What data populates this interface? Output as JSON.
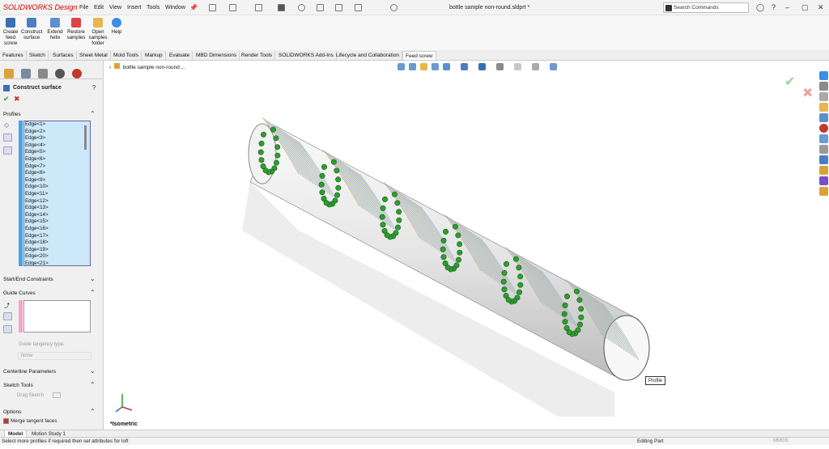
{
  "titlebar": {
    "app_name": "SOLIDWORKS Design",
    "menus": [
      "File",
      "Edit",
      "View",
      "Insert",
      "Tools",
      "Window"
    ],
    "document_title": "bottle sample non-round.sldprt *",
    "search_placeholder": "Search Commands"
  },
  "command_manager": {
    "tools": [
      {
        "label": "Create feed screw",
        "icon": "feed-screw-icon"
      },
      {
        "label": "Construct surface",
        "icon": "construct-surface-icon"
      },
      {
        "label": "Extend helix",
        "icon": "extend-helix-icon"
      },
      {
        "label": "Restore samples",
        "icon": "restore-samples-icon"
      },
      {
        "label": "Open samples folder",
        "icon": "folder-icon"
      },
      {
        "label": "Help",
        "icon": "help-icon"
      }
    ],
    "tabs": [
      "Features",
      "Sketch",
      "Surfaces",
      "Sheet Metal",
      "Mold Tools",
      "Markup",
      "Evaluate",
      "MBD Dimensions",
      "Render Tools",
      "SOLIDWORKS Add-Ins",
      "Lifecycle and Collaboration",
      "Feed screw"
    ],
    "active_tab": "Feed screw"
  },
  "property_manager": {
    "title": "Construct surface",
    "sections": {
      "profiles": "Profiles",
      "start_end": "Start/End Constraints",
      "guide_curves": "Guide Curves",
      "guide_tangency_label": "Guide tangency type:",
      "guide_tangency_value": "None",
      "centerline": "Centerline Parameters",
      "sketch_tools": "Sketch Tools",
      "drag_sketch": "Drag Sketch",
      "options": "Options",
      "merge_tangent": "Merge tangent faces"
    },
    "profiles": [
      "Edge<1>",
      "Edge<2>",
      "Edge<3>",
      "Edge<4>",
      "Edge<5>",
      "Edge<6>",
      "Edge<7>",
      "Edge<8>",
      "Edge<9>",
      "Edge<10>",
      "Edge<11>",
      "Edge<12>",
      "Edge<13>",
      "Edge<14>",
      "Edge<15>",
      "Edge<16>",
      "Edge<17>",
      "Edge<18>",
      "Edge<19>",
      "Edge<20>",
      "Edge<21>"
    ]
  },
  "viewport": {
    "tree_item": "bottle sample non-round ...",
    "view_label": "*Isometric",
    "profile_tag": "Profile"
  },
  "bottom_tabs": [
    "Model",
    "Motion Study 1"
  ],
  "status": {
    "message": "Select more profiles if required then set attributes for loft",
    "mode": "Editing Part",
    "units": "MMGS"
  },
  "colors": {
    "accent": "#4aa3e3",
    "brand": "#cc0000",
    "helix_point": "#2e9e2e"
  }
}
